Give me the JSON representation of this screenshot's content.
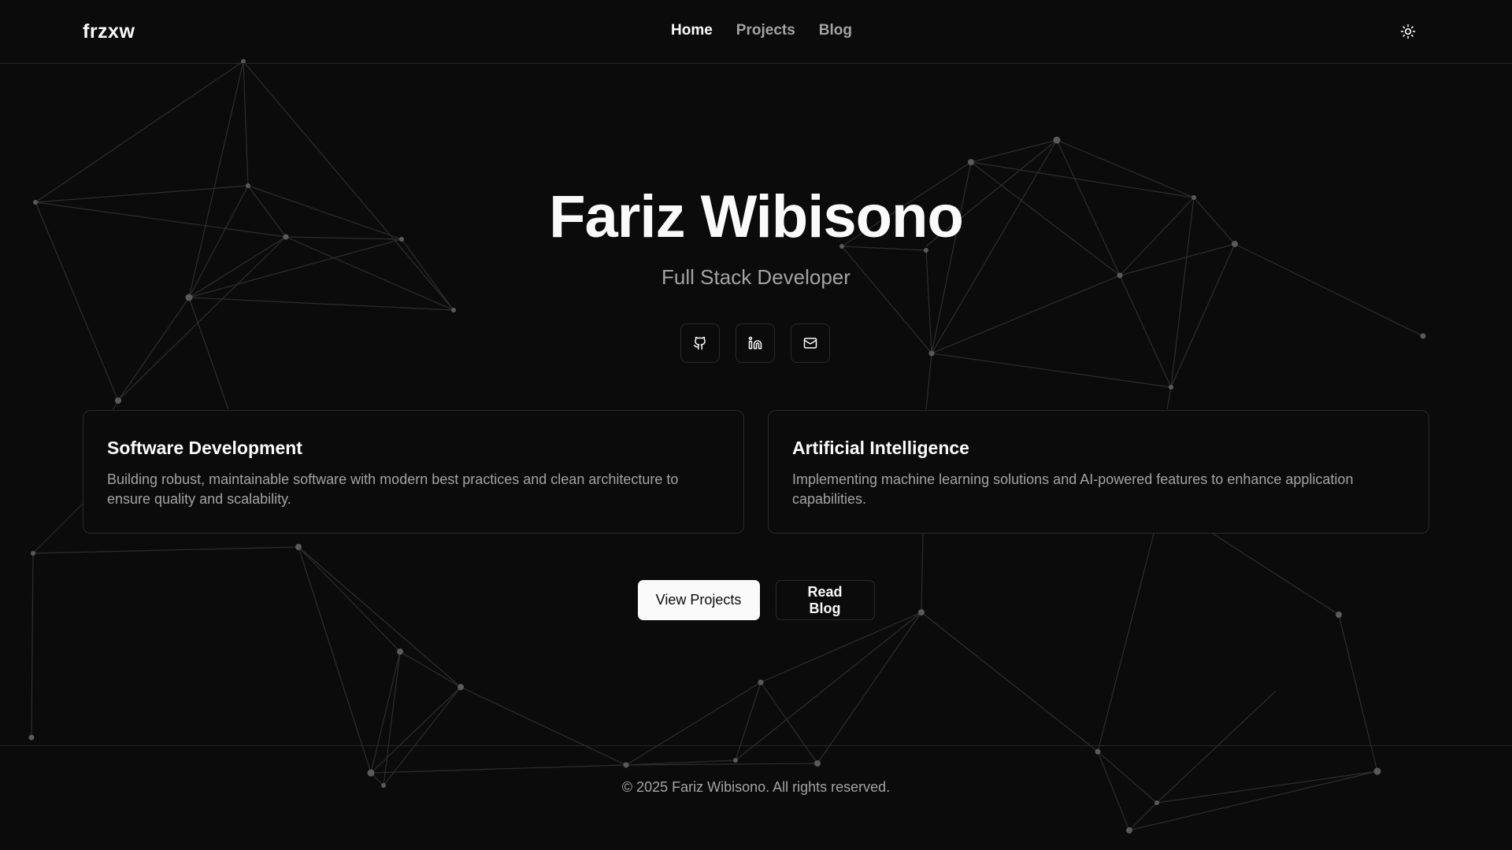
{
  "header": {
    "logo": "frzxw",
    "nav": [
      {
        "label": "Home",
        "active": true
      },
      {
        "label": "Projects",
        "active": false
      },
      {
        "label": "Blog",
        "active": false
      }
    ],
    "theme_toggle_icon": "sun-icon"
  },
  "hero": {
    "name": "Fariz Wibisono",
    "role": "Full Stack Developer",
    "socials": [
      {
        "icon": "github-icon"
      },
      {
        "icon": "linkedin-icon"
      },
      {
        "icon": "mail-icon"
      }
    ]
  },
  "cards": [
    {
      "title": "Software Development",
      "description": "Building robust, maintainable software with modern best practices and clean architecture to ensure quality and scalability."
    },
    {
      "title": "Artificial Intelligence",
      "description": "Implementing machine learning solutions and AI-powered features to enhance application capabilities."
    }
  ],
  "actions": {
    "primary_label": "View Projects",
    "secondary_label": "Read Blog"
  },
  "footer": {
    "copyright": "© 2025 Fariz Wibisono. All rights reserved."
  },
  "colors": {
    "background": "#0b0b0b",
    "foreground": "#fafafa",
    "muted": "#a3a3a3",
    "border": "#2a2a2a"
  }
}
